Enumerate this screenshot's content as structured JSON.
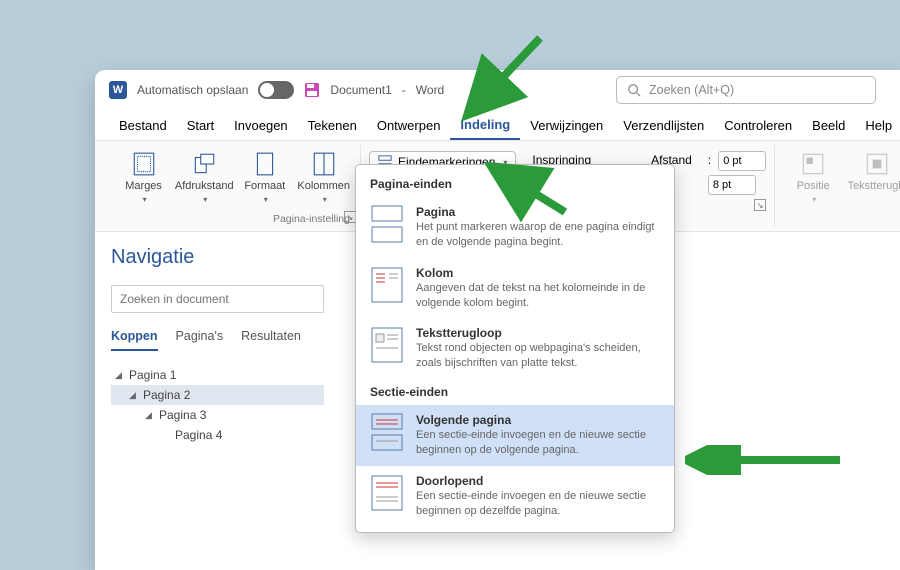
{
  "titlebar": {
    "autosave": "Automatisch opslaan",
    "doc_name": "Document1",
    "app_name": "Word",
    "search_placeholder": "Zoeken (Alt+Q)"
  },
  "tabs": [
    "Bestand",
    "Start",
    "Invoegen",
    "Tekenen",
    "Ontwerpen",
    "Indeling",
    "Verwijzingen",
    "Verzendlijsten",
    "Controleren",
    "Beeld",
    "Help"
  ],
  "active_tab": "Indeling",
  "ribbon": {
    "marges": "Marges",
    "afdrukstand": "Afdrukstand",
    "formaat": "Formaat",
    "kolommen": "Kolommen",
    "eindemarkeringen": "Eindemarkeringen",
    "page_setup_label": "Pagina-instelling",
    "inspringing": "Inspringing",
    "afstand": "Afstand",
    "spacing_before": "0 pt",
    "spacing_after": "8 pt",
    "positie": "Positie",
    "tekstterugloop": "Tekstteruglo"
  },
  "sidebar": {
    "title": "Navigatie",
    "search_placeholder": "Zoeken in document",
    "tabs": [
      "Koppen",
      "Pagina's",
      "Resultaten"
    ],
    "tree": [
      "Pagina 1",
      "Pagina 2",
      "Pagina 3",
      "Pagina 4"
    ]
  },
  "dropdown": {
    "section1": "Pagina-einden",
    "items1": [
      {
        "title": "Pagina",
        "desc": "Het punt markeren waarop de ene pagina eindigt en de volgende pagina begint."
      },
      {
        "title": "Kolom",
        "desc": "Aangeven dat de tekst na het kolomeinde in de volgende kolom begint."
      },
      {
        "title": "Tekstterugloop",
        "desc": "Tekst rond objecten op webpagina's scheiden, zoals bijschriften van platte tekst."
      }
    ],
    "section2": "Sectie-einden",
    "items2": [
      {
        "title": "Volgende pagina",
        "desc": "Een sectie-einde invoegen en de nieuwe sectie beginnen op de volgende pagina."
      },
      {
        "title": "Doorlopend",
        "desc": "Een sectie-einde invoegen en de nieuwe sectie beginnen op dezelfde pagina."
      }
    ]
  }
}
